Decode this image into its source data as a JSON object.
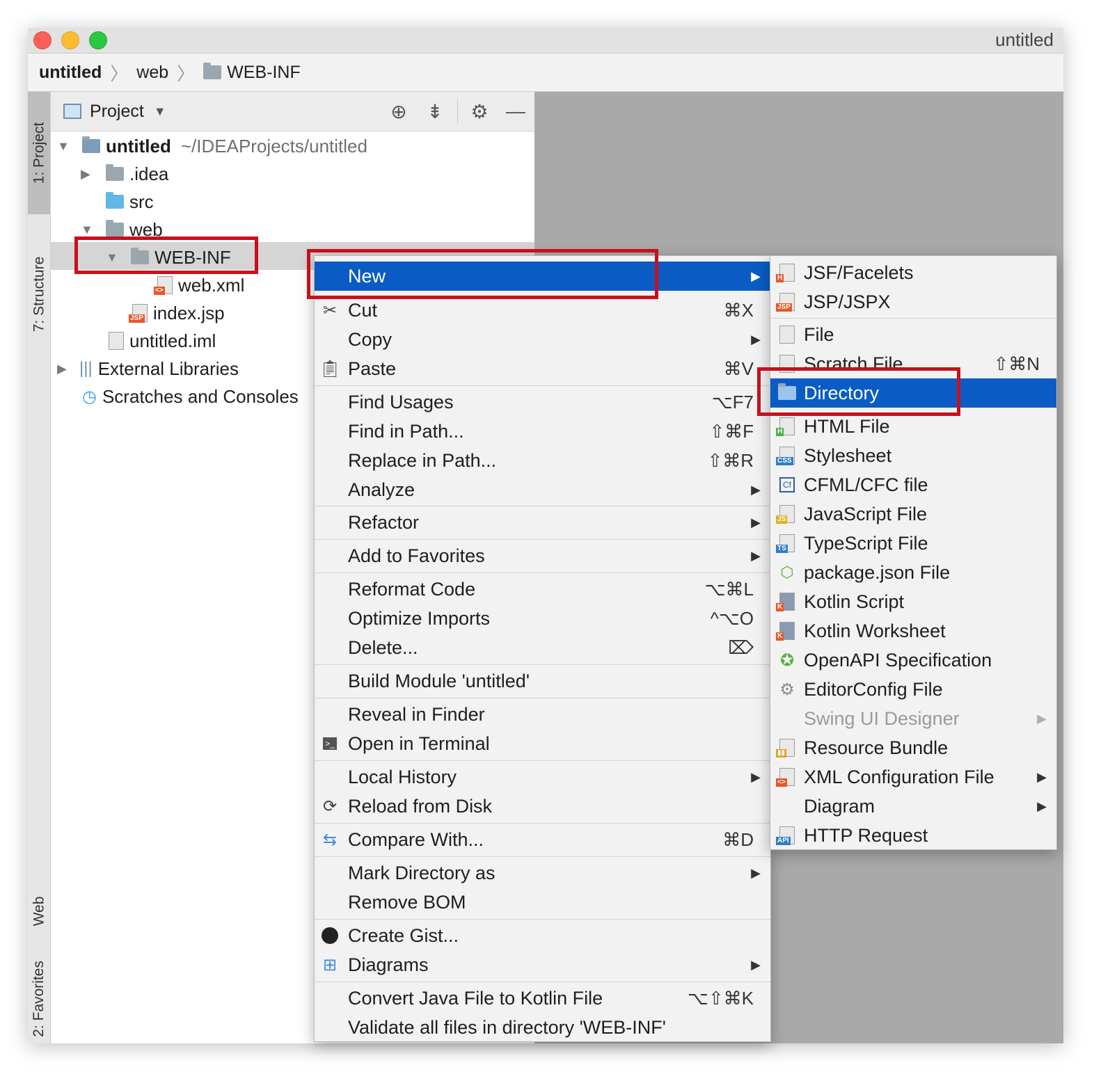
{
  "window": {
    "title": "untitled"
  },
  "breadcrumb": {
    "items": [
      "untitled",
      "web",
      "WEB-INF"
    ]
  },
  "stripe": {
    "project_tab": "1: Project",
    "structure_tab": "7: Structure",
    "web_tab": "Web",
    "favorites_tab": "2: Favorites"
  },
  "project_panel": {
    "title": "Project",
    "tree": {
      "root_name": "untitled",
      "root_path": "~/IDEAProjects/untitled",
      "idea": ".idea",
      "src": "src",
      "web": "web",
      "webinf": "WEB-INF",
      "webxml": "web.xml",
      "indexjsp": "index.jsp",
      "iml": "untitled.iml",
      "extlibs": "External Libraries",
      "scratches": "Scratches and Consoles"
    }
  },
  "context_menu": {
    "new": "New",
    "cut": "Cut",
    "cut_sc": "⌘X",
    "copy": "Copy",
    "paste": "Paste",
    "paste_sc": "⌘V",
    "find_usages": "Find Usages",
    "find_usages_sc": "⌥F7",
    "find_in_path": "Find in Path...",
    "find_in_path_sc": "⇧⌘F",
    "replace_in_path": "Replace in Path...",
    "replace_in_path_sc": "⇧⌘R",
    "analyze": "Analyze",
    "refactor": "Refactor",
    "add_to_favorites": "Add to Favorites",
    "reformat_code": "Reformat Code",
    "reformat_code_sc": "⌥⌘L",
    "optimize_imports": "Optimize Imports",
    "optimize_imports_sc": "^⌥O",
    "delete": "Delete...",
    "delete_sc": "⌦",
    "build_module": "Build Module 'untitled'",
    "reveal_in_finder": "Reveal in Finder",
    "open_in_terminal": "Open in Terminal",
    "local_history": "Local History",
    "reload_from_disk": "Reload from Disk",
    "compare_with": "Compare With...",
    "compare_with_sc": "⌘D",
    "mark_directory_as": "Mark Directory as",
    "remove_bom": "Remove BOM",
    "create_gist": "Create Gist...",
    "diagrams": "Diagrams",
    "convert_java": "Convert Java File to Kotlin File",
    "convert_java_sc": "⌥⇧⌘K",
    "validate_all": "Validate all files in directory 'WEB-INF'"
  },
  "submenu": {
    "jsf": "JSF/Facelets",
    "jsp": "JSP/JSPX",
    "file": "File",
    "scratch": "Scratch File",
    "scratch_sc": "⇧⌘N",
    "directory": "Directory",
    "html": "HTML File",
    "stylesheet": "Stylesheet",
    "cfml": "CFML/CFC file",
    "javascript": "JavaScript File",
    "typescript": "TypeScript File",
    "packagejson": "package.json File",
    "kotlin_script": "Kotlin Script",
    "kotlin_worksheet": "Kotlin Worksheet",
    "openapi": "OpenAPI Specification",
    "editorconfig": "EditorConfig File",
    "swing": "Swing UI Designer",
    "resource_bundle": "Resource Bundle",
    "xml_config": "XML Configuration File",
    "diagram": "Diagram",
    "http_request": "HTTP Request"
  },
  "colors": {
    "selection": "#0a5cc4",
    "highlight_box": "#c8101c",
    "menu_bg": "#f2f2f2"
  }
}
